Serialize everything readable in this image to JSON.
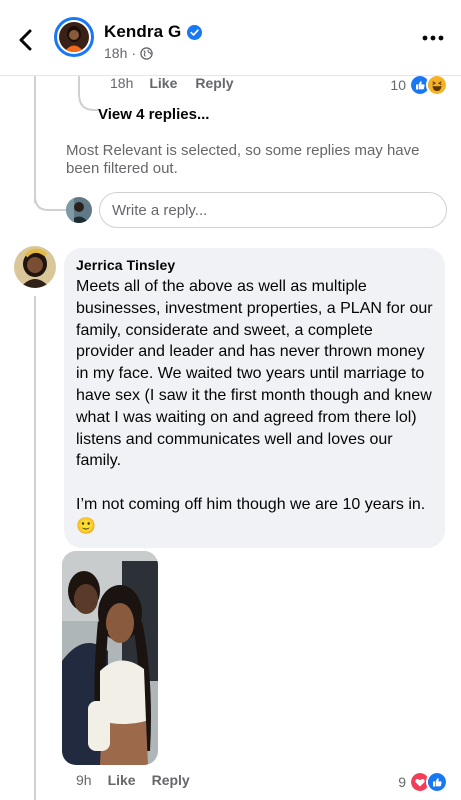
{
  "header": {
    "name": "Kendra G",
    "time": "18h",
    "separator": "·",
    "icons": {
      "back": "chevron-left-icon",
      "verified": "verified-badge-icon",
      "privacy": "globe-icon",
      "more": "more-dots-icon"
    }
  },
  "previous_reply": {
    "time": "18h",
    "like_label": "Like",
    "reply_label": "Reply",
    "reaction_count": "10",
    "reaction_icons": [
      "like-reaction-icon",
      "haha-reaction-icon"
    ]
  },
  "view_replies": "View 4 replies...",
  "filter_note": "Most Relevant is selected, so some replies may have been filtered out.",
  "reply_box": {
    "placeholder": "Write a reply..."
  },
  "comment": {
    "author": "Jerrica Tinsley",
    "text": "Meets all of the above as well as multiple businesses, investment properties, a PLAN for our family, considerate and sweet, a complete provider and leader and has never thrown money in my face. We waited two years until marriage to have sex (I saw it the first month though and knew what I was waiting on and agreed from there lol) listens and communicates well and loves our family.\n\nI’m not coming off him though we are 10 years in. 🙂",
    "time": "9h",
    "like_label": "Like",
    "reply_label": "Reply",
    "reaction_count": "9",
    "reaction_icons": [
      "love-reaction-icon",
      "like-reaction-icon"
    ]
  },
  "colors": {
    "accent": "#1877f2",
    "love": "#f33e58",
    "haha": "#f7b125",
    "bubble": "#f0f2f5",
    "secondary_text": "#65676b"
  }
}
